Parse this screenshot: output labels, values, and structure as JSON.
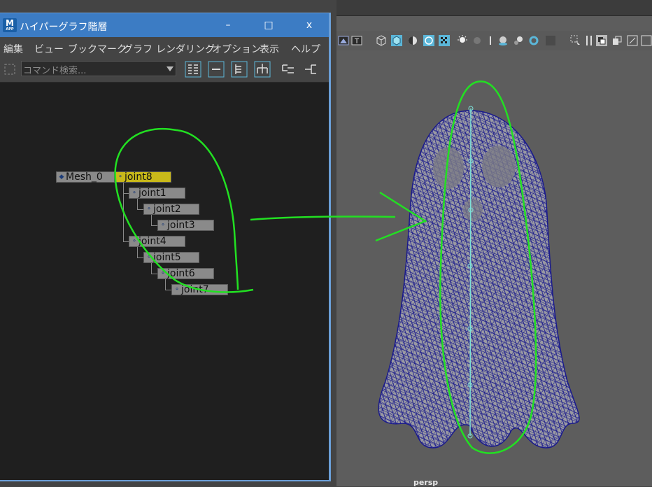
{
  "window": {
    "title": "ハイパーグラフ階層",
    "logo_letter": "M",
    "logo_sub": "APP",
    "minimize": "–",
    "maximize": "□",
    "close": "x"
  },
  "menu": [
    "編集",
    "ビュー",
    "ブックマーク",
    "グラフ",
    "レンダリング",
    "オプション",
    "表示",
    "ヘルプ"
  ],
  "search": {
    "placeholder": "コマンド検索..."
  },
  "hierarchy": {
    "root": "Mesh_0",
    "nodes": [
      "joint8",
      "joint1",
      "joint2",
      "joint3",
      "joint4",
      "joint5",
      "joint6",
      "joint7"
    ],
    "selected": "joint8"
  },
  "viewport": {
    "camera": "persp"
  },
  "colors": {
    "title_bar": "#3c7cc4",
    "selected_node": "#c9b91a",
    "wireframe": "#1a1a8c",
    "skeleton": "#7de0d8",
    "annotation": "#22e022"
  }
}
